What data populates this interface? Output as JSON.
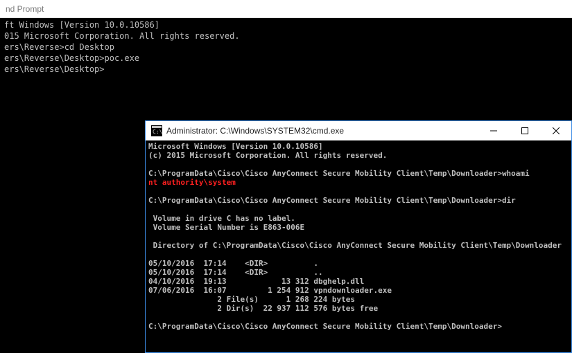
{
  "outer": {
    "titlebar_partial": "nd Prompt",
    "lines": [
      "ft Windows [Version 10.0.10586]",
      "015 Microsoft Corporation. All rights reserved.",
      "",
      "ers\\Reverse>cd Desktop",
      "",
      "ers\\Reverse\\Desktop>poc.exe",
      "",
      "ers\\Reverse\\Desktop>"
    ]
  },
  "inner": {
    "title": "Administrator: C:\\Windows\\SYSTEM32\\cmd.exe",
    "header1": "Microsoft Windows [Version 10.0.10586]",
    "header2": "(c) 2015 Microsoft Corporation. All rights reserved.",
    "prompt_path": "C:\\ProgramData\\Cisco\\Cisco AnyConnect Secure Mobility Client\\Temp\\Downloader>",
    "cmd_whoami": "whoami",
    "whoami_output": "nt authority\\system",
    "cmd_dir": "dir",
    "vol_line1": " Volume in drive C has no label.",
    "vol_line2": " Volume Serial Number is E863-006E",
    "dir_of": " Directory of C:\\ProgramData\\Cisco\\Cisco AnyConnect Secure Mobility Client\\Temp\\Downloader",
    "entries": [
      "05/10/2016  17:14    <DIR>          .",
      "05/10/2016  17:14    <DIR>          ..",
      "04/10/2016  19:13            13 312 dbghelp.dll",
      "07/06/2016  16:07         1 254 912 vpndownloader.exe",
      "               2 File(s)      1 268 224 bytes",
      "               2 Dir(s)  22 937 112 576 bytes free"
    ]
  }
}
